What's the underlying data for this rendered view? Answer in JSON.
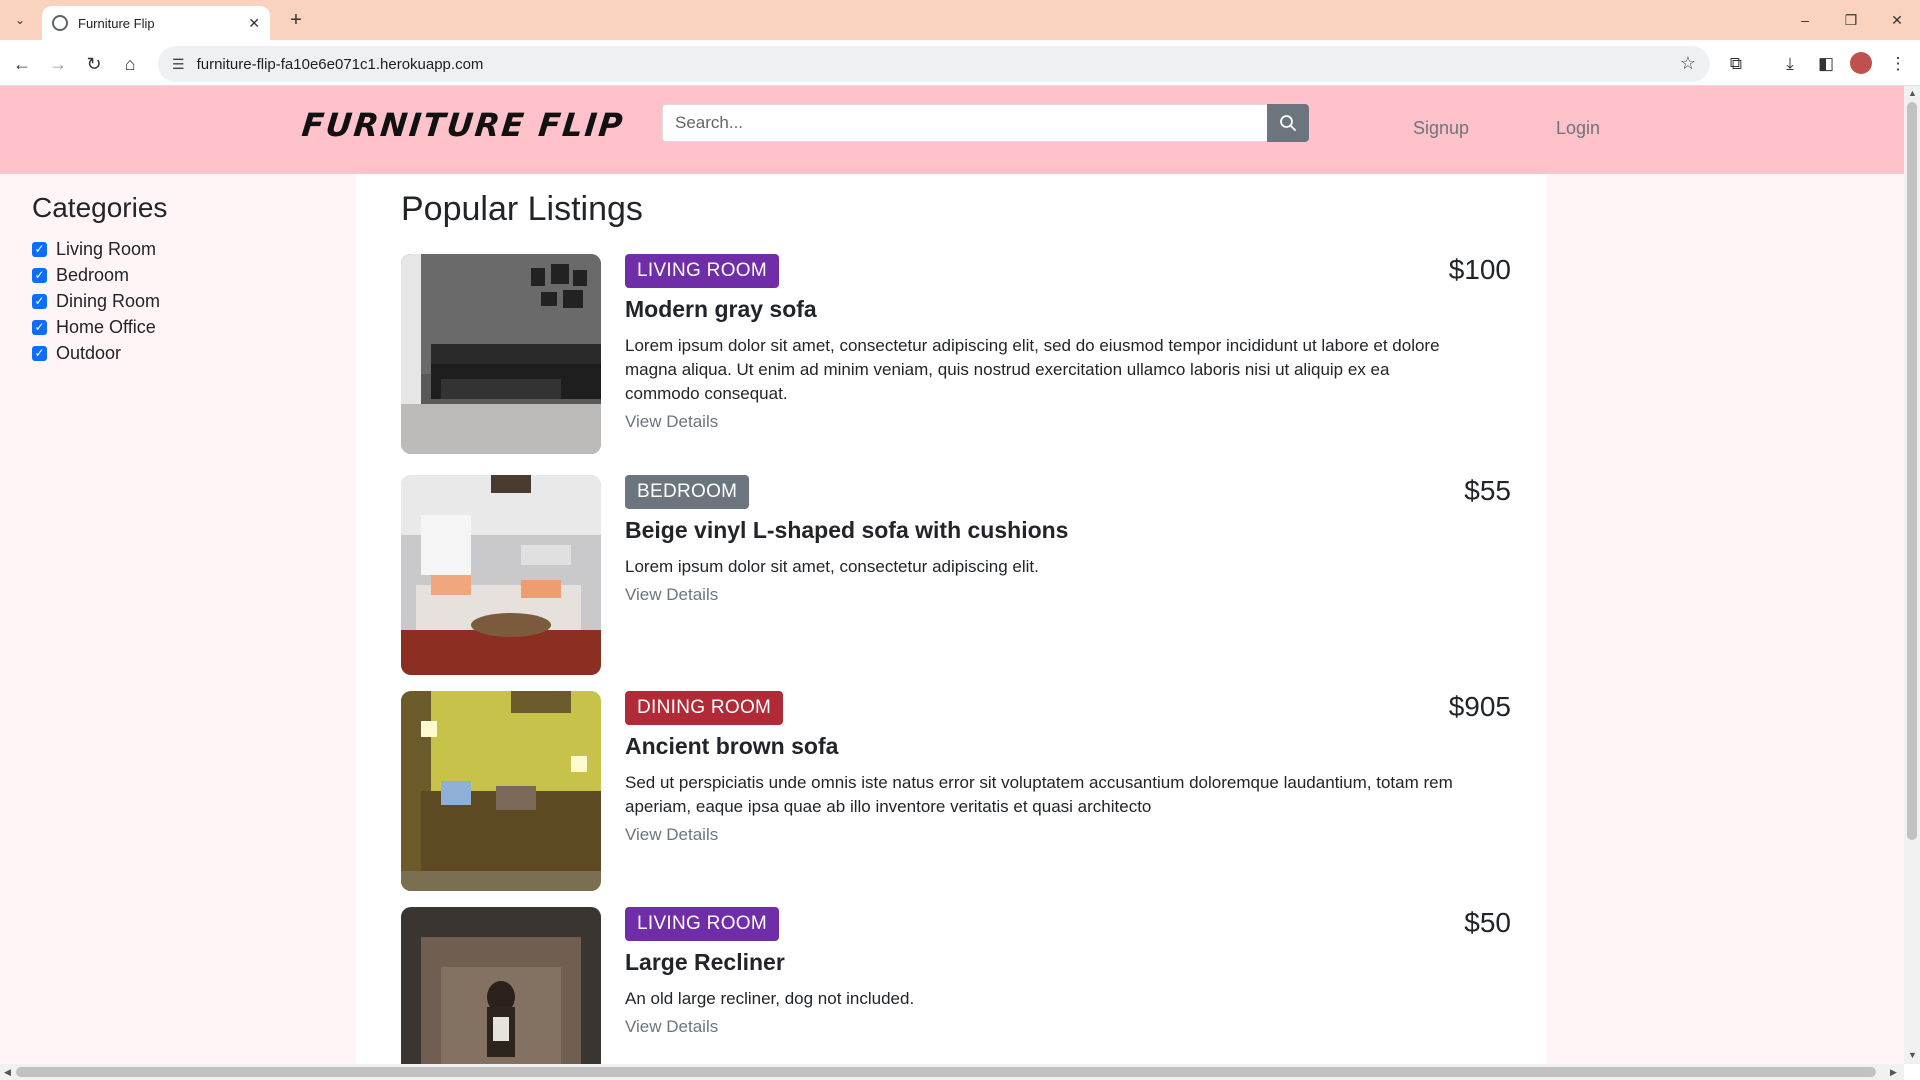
{
  "browser": {
    "tab_title": "Furniture Flip",
    "url": "furniture-flip-fa10e6e071c1.herokuapp.com"
  },
  "header": {
    "logo": "FURNITURE FLIP",
    "search_placeholder": "Search...",
    "signup": "Signup",
    "login": "Login"
  },
  "sidebar": {
    "title": "Categories",
    "categories": [
      {
        "label": "Living Room",
        "checked": true
      },
      {
        "label": "Bedroom",
        "checked": true
      },
      {
        "label": "Dining Room",
        "checked": true
      },
      {
        "label": "Home Office",
        "checked": true
      },
      {
        "label": "Outdoor",
        "checked": true
      }
    ]
  },
  "main": {
    "title": "Popular Listings",
    "view_details": "View Details",
    "listings": [
      {
        "category": "LIVING ROOM",
        "badge_color": "#6f2da8",
        "name": "Modern gray sofa",
        "description": "Lorem ipsum dolor sit amet, consectetur adipiscing elit, sed do eiusmod tempor incididunt ut labore et dolore magna aliqua. Ut enim ad minim veniam, quis nostrud exercitation ullamco laboris nisi ut aliquip ex ea commodo consequat.",
        "price": "$100"
      },
      {
        "category": "BEDROOM",
        "badge_color": "#6c757d",
        "name": "Beige vinyl L-shaped sofa with cushions",
        "description": "Lorem ipsum dolor sit amet, consectetur adipiscing elit.",
        "price": "$55"
      },
      {
        "category": "DINING ROOM",
        "badge_color": "#b02a37",
        "name": "Ancient brown sofa",
        "description": "Sed ut perspiciatis unde omnis iste natus error sit voluptatem accusantium doloremque laudantium, totam rem aperiam, eaque ipsa quae ab illo inventore veritatis et quasi architecto",
        "price": "$905"
      },
      {
        "category": "LIVING ROOM",
        "badge_color": "#6f2da8",
        "name": "Large Recliner",
        "description": "An old large recliner, dog not included.",
        "price": "$50"
      }
    ]
  },
  "icons": {
    "tab_menu": "chevron-down-icon",
    "search": "search-icon",
    "star": "star-icon"
  }
}
